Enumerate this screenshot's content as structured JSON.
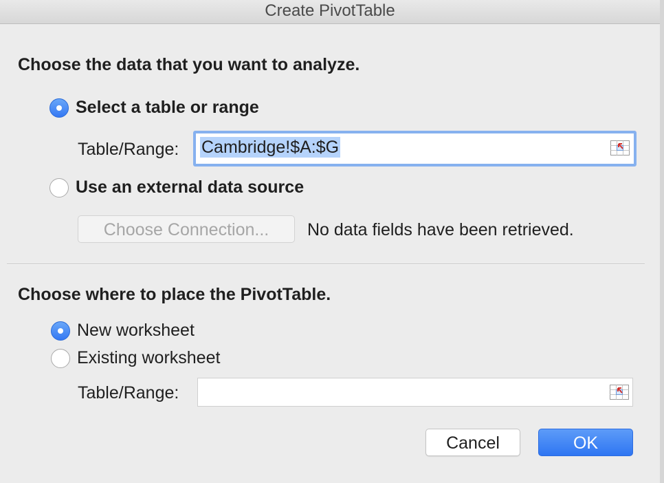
{
  "window": {
    "title": "Create PivotTable"
  },
  "source_section": {
    "heading": "Choose the data that you want to analyze.",
    "option_table_range": {
      "label": "Select a table or range",
      "selected": true
    },
    "table_range_label": "Table/Range:",
    "table_range_value": "Cambridge!$A:$G",
    "option_external": {
      "label": "Use an external data source",
      "selected": false
    },
    "choose_connection_label": "Choose Connection...",
    "no_fields_message": "No data fields have been retrieved."
  },
  "destination_section": {
    "heading": "Choose where to place the PivotTable.",
    "option_new_worksheet": {
      "label": "New worksheet",
      "selected": true
    },
    "option_existing_worksheet": {
      "label": "Existing worksheet",
      "selected": false
    },
    "table_range_label": "Table/Range:",
    "table_range_value": ""
  },
  "buttons": {
    "cancel_label": "Cancel",
    "ok_label": "OK"
  },
  "icons": {
    "range_picker": "range-picker-icon"
  },
  "colors": {
    "accent": "#3478f3",
    "selection_highlight": "#b5d3fb",
    "focus_ring": "#86b1ef"
  }
}
